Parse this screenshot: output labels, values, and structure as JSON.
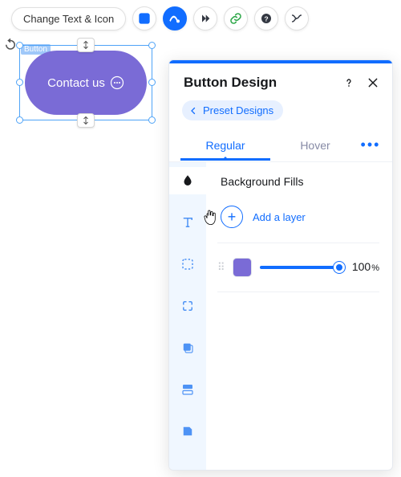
{
  "toolbar": {
    "change_text_label": "Change Text & Icon",
    "items": [
      "layout",
      "design",
      "animations",
      "link",
      "help",
      "stretch"
    ]
  },
  "canvas": {
    "element_label": "Button",
    "button_text": "Contact us"
  },
  "panel": {
    "title": "Button Design",
    "preset_label": "Preset Designs",
    "tabs": {
      "regular": "Regular",
      "hover": "Hover"
    },
    "active_tab": "regular",
    "rail": [
      "fill",
      "text",
      "border",
      "corners",
      "shadow",
      "spacing",
      "other"
    ],
    "active_rail": "fill",
    "fills": {
      "section_title": "Background Fills",
      "add_label": "Add a layer",
      "layers": [
        {
          "color": "#7a6bd6",
          "opacity": 100
        }
      ]
    }
  }
}
